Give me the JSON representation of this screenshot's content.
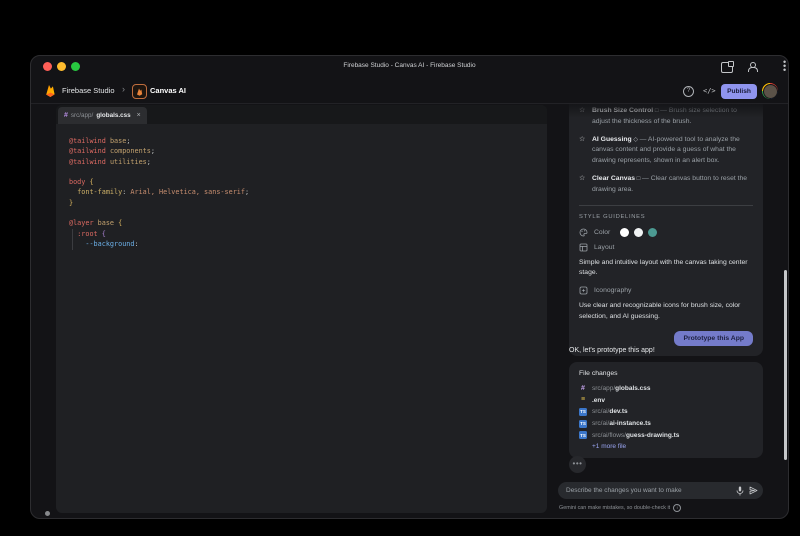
{
  "titlebar": {
    "title": "Firebase Studio - Canvas AI - Firebase Studio"
  },
  "header": {
    "brand": "Firebase Studio",
    "app_name": "Canvas AI",
    "publish_label": "Publish",
    "code_toggle": "</>",
    "help_glyph": "?"
  },
  "editor": {
    "tab_path": "src/app/",
    "tab_file": "globals.css",
    "close_glyph": "×",
    "code_lines": [
      [
        {
          "t": "@tailwind",
          "c": "at"
        },
        {
          "t": " ",
          "c": "pn"
        },
        {
          "t": "base",
          "c": "arg"
        },
        {
          "t": ";",
          "c": "pn"
        }
      ],
      [
        {
          "t": "@tailwind",
          "c": "at"
        },
        {
          "t": " ",
          "c": "pn"
        },
        {
          "t": "components",
          "c": "arg"
        },
        {
          "t": ";",
          "c": "pn"
        }
      ],
      [
        {
          "t": "@tailwind",
          "c": "at"
        },
        {
          "t": " ",
          "c": "pn"
        },
        {
          "t": "utilities",
          "c": "arg"
        },
        {
          "t": ";",
          "c": "pn"
        }
      ],
      [],
      [
        {
          "t": "body",
          "c": "sel"
        },
        {
          "t": " ",
          "c": "pn"
        },
        {
          "t": "{",
          "c": "br"
        }
      ],
      [
        {
          "t": "  ",
          "c": "pn"
        },
        {
          "t": "font-family",
          "c": "prop"
        },
        {
          "t": ":",
          "c": "pn"
        },
        {
          "t": " Arial, Helvetica, sans-serif",
          "c": "str"
        },
        {
          "t": ";",
          "c": "pn"
        }
      ],
      [
        {
          "t": "}",
          "c": "br"
        }
      ],
      [],
      [
        {
          "t": "@layer",
          "c": "at"
        },
        {
          "t": " ",
          "c": "pn"
        },
        {
          "t": "base",
          "c": "arg"
        },
        {
          "t": " ",
          "c": "pn"
        },
        {
          "t": "{",
          "c": "br"
        }
      ],
      [
        {
          "t": "  ",
          "c": "pn"
        },
        {
          "t": ":root",
          "c": "sel"
        },
        {
          "t": " ",
          "c": "pn"
        },
        {
          "t": "{",
          "c": "br2"
        }
      ],
      [
        {
          "t": "    ",
          "c": "pn"
        },
        {
          "t": "--background",
          "c": "var"
        },
        {
          "t": ":",
          "c": "pn"
        }
      ]
    ]
  },
  "chat": {
    "features": [
      {
        "name": "Brush Size Control",
        "icon": "□",
        "desc": "— Brush size selection to adjust the thickness of the brush."
      },
      {
        "name": "AI Guessing",
        "icon": "◇",
        "desc": "— AI-powered tool to analyze the canvas content and provide a guess of what the drawing represents, shown in an alert box."
      },
      {
        "name": "Clear Canvas",
        "icon": "□",
        "desc": "— Clear canvas button to reset the drawing area."
      }
    ],
    "style_guidelines_label": "STYLE GUIDELINES",
    "color_label": "Color",
    "color_swatches": [
      "#ffffff",
      "#f1f3f4",
      "#4c9a92"
    ],
    "layout_label": "Layout",
    "layout_desc": "Simple and intuitive layout with the canvas taking center stage.",
    "iconography_label": "Iconography",
    "iconography_desc": "Use clear and recognizable icons for brush size, color selection, and AI guessing.",
    "prototype_button_label": "Prototype this App",
    "message": "OK, let's prototype this app!",
    "file_changes": {
      "title": "File changes",
      "files": [
        {
          "path": "src/app/",
          "name": "globals.css",
          "type": "css"
        },
        {
          "path": "",
          "name": ".env",
          "type": "env"
        },
        {
          "path": "src/ai/",
          "name": "dev.ts",
          "type": "ts"
        },
        {
          "path": "src/ai/",
          "name": "ai-instance.ts",
          "type": "ts"
        },
        {
          "path": "src/ai/flows/",
          "name": "guess-drawing.ts",
          "type": "ts"
        }
      ],
      "more_label": "+1 more file"
    },
    "typing_glyph": "•••",
    "input_placeholder": "Describe the changes you want to make",
    "disclaimer": "Gemini can make mistakes, so double-check it"
  }
}
